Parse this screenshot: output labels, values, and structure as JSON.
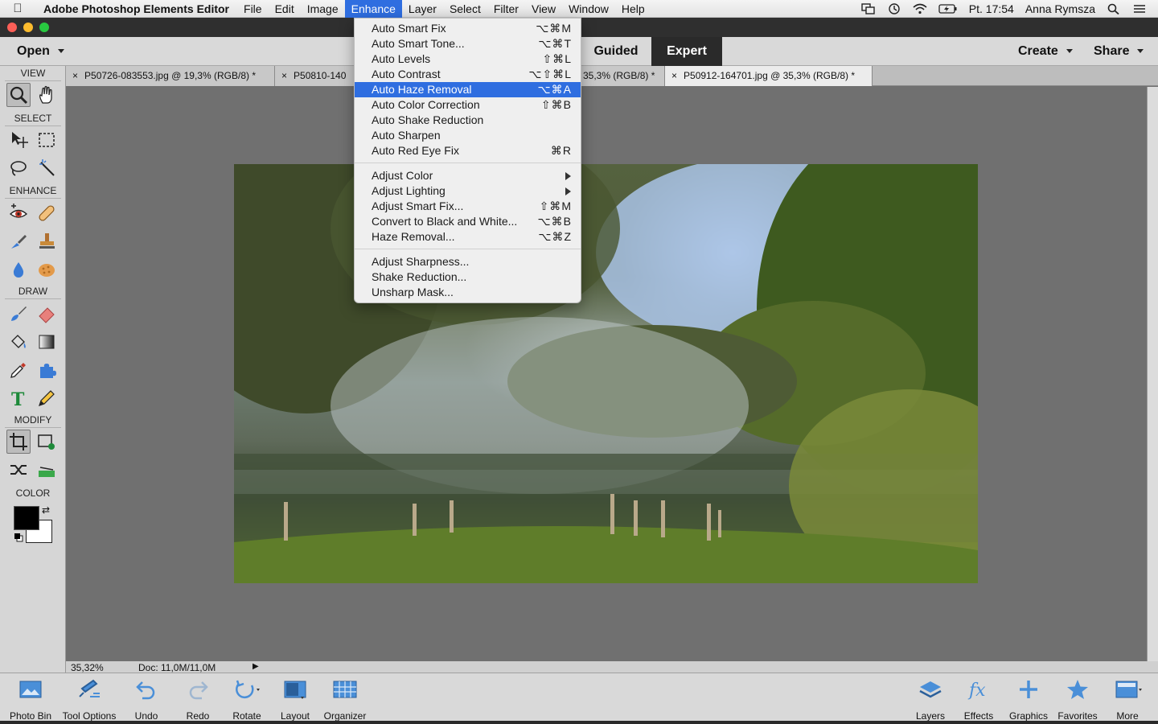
{
  "menubar": {
    "app_name": "Adobe Photoshop Elements Editor",
    "items": [
      "File",
      "Edit",
      "Image",
      "Enhance",
      "Layer",
      "Select",
      "Filter",
      "View",
      "Window",
      "Help"
    ],
    "clock": "Pt. 17:54",
    "user": "Anna Rymsza"
  },
  "modebar": {
    "open_label": "Open",
    "guided_label": "Guided",
    "expert_label": "Expert",
    "create_label": "Create",
    "share_label": "Share"
  },
  "tabs": [
    "P50726-083553.jpg @ 19,3% (RGB/8) *",
    "P50810-140",
    "35,3% (RGB/8) *",
    "P50912-164701.jpg @ 35,3% (RGB/8) *"
  ],
  "toolbox": {
    "view": "VIEW",
    "select": "SELECT",
    "enhance": "ENHANCE",
    "draw": "DRAW",
    "modify": "MODIFY",
    "color": "COLOR"
  },
  "status": {
    "zoom": "35,32%",
    "doc": "Doc: 11,0M/11,0M"
  },
  "enhance_menu": {
    "group1": [
      {
        "label": "Auto Smart Fix",
        "shortcut": "⌥⌘M"
      },
      {
        "label": "Auto Smart Tone...",
        "shortcut": "⌥⌘T"
      },
      {
        "label": "Auto Levels",
        "shortcut": "⇧⌘L"
      },
      {
        "label": "Auto Contrast",
        "shortcut": "⌥⇧⌘L"
      },
      {
        "label": "Auto Haze Removal",
        "shortcut": "⌥⌘A"
      },
      {
        "label": "Auto Color Correction",
        "shortcut": "⇧⌘B"
      },
      {
        "label": "Auto Shake Reduction",
        "shortcut": ""
      },
      {
        "label": "Auto Sharpen",
        "shortcut": ""
      },
      {
        "label": "Auto Red Eye Fix",
        "shortcut": "⌘R"
      }
    ],
    "group2": [
      {
        "label": "Adjust Color",
        "shortcut": ""
      },
      {
        "label": "Adjust Lighting",
        "shortcut": ""
      },
      {
        "label": "Adjust Smart Fix...",
        "shortcut": "⇧⌘M"
      },
      {
        "label": "Convert to Black and White...",
        "shortcut": "⌥⌘B"
      },
      {
        "label": "Haze Removal...",
        "shortcut": "⌥⌘Z"
      }
    ],
    "group3": [
      {
        "label": "Adjust Sharpness...",
        "shortcut": ""
      },
      {
        "label": "Shake Reduction...",
        "shortcut": ""
      },
      {
        "label": "Unsharp Mask...",
        "shortcut": ""
      }
    ]
  },
  "bottombar": {
    "photo_bin": "Photo Bin",
    "tool_options": "Tool Options",
    "undo": "Undo",
    "redo": "Redo",
    "rotate": "Rotate",
    "layout": "Layout",
    "organizer": "Organizer",
    "layers": "Layers",
    "effects": "Effects",
    "graphics": "Graphics",
    "favorites": "Favorites",
    "more": "More"
  },
  "colors": {
    "accent": "#2f6ee0",
    "foreground_swatch": "#000000",
    "background_swatch": "#ffffff"
  }
}
